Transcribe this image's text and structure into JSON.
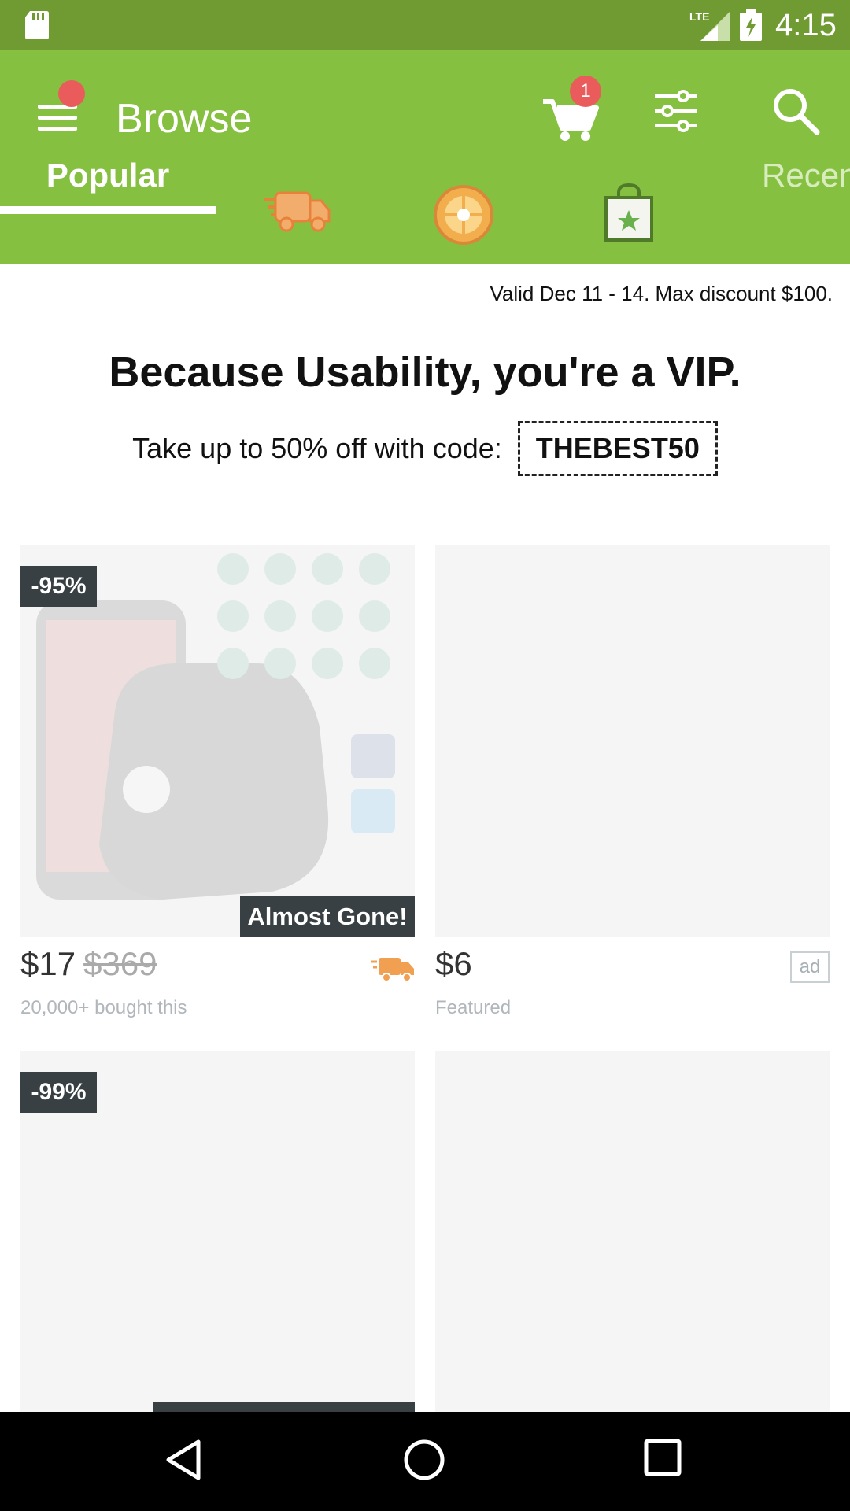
{
  "status_bar": {
    "time": "4:15",
    "network": "LTE"
  },
  "app_bar": {
    "title": "Browse",
    "cart_count": "1",
    "icons": [
      "menu-icon",
      "cart-icon",
      "filter-icon",
      "search-icon"
    ]
  },
  "tabs": {
    "items": [
      {
        "label": "Popular",
        "selected": true
      },
      {
        "icon": "delivery-truck-icon"
      },
      {
        "icon": "prize-wheel-icon"
      },
      {
        "icon": "shopping-bag-star-icon"
      },
      {
        "label": "Recen"
      }
    ]
  },
  "promo": {
    "validity": "Valid Dec 11 - 14. Max discount $100.",
    "title": "Because Usability, you're a VIP.",
    "text": "Take up to 50% off with code:",
    "code": "THEBEST50"
  },
  "products": [
    {
      "discount": "-95%",
      "badge": "Almost Gone!",
      "price": "$17",
      "original_price": "$369",
      "subtext": "20,000+ bought this",
      "fast_shipping": true
    },
    {
      "price": "$6",
      "ad_label": "ad",
      "subtext": "Featured"
    },
    {
      "discount": "-99%"
    },
    {}
  ],
  "colors": {
    "status_bar": "#6f9b32",
    "app_bar": "#86c041",
    "badge": "#ea5b5b",
    "label_bg": "#384043",
    "truck": "#f0a050"
  }
}
